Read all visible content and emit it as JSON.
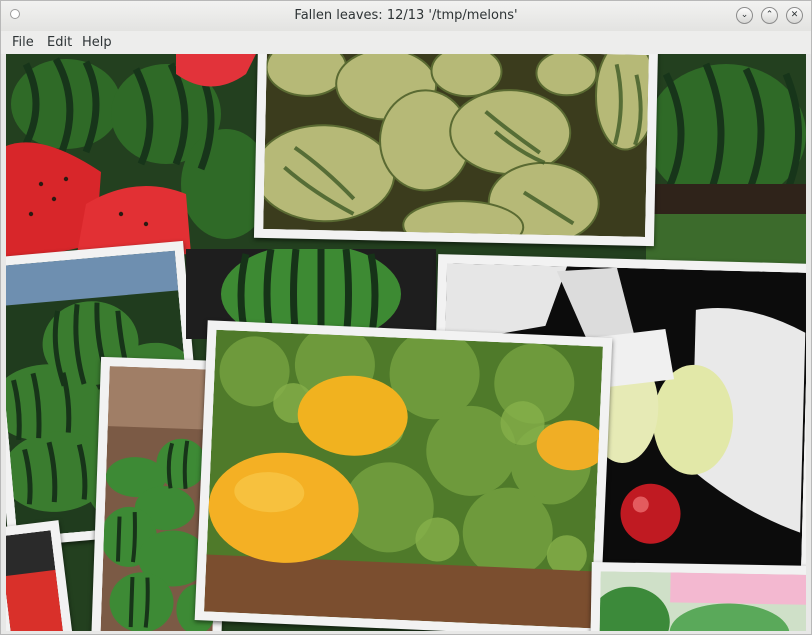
{
  "window": {
    "title": "Fallen leaves: 12/13 '/tmp/melons'",
    "minimize_icon": "chevron-down-icon",
    "maximize_icon": "chevron-up-icon",
    "close_icon": "close-icon"
  },
  "menu": {
    "file": "File",
    "edit": "Edit",
    "help": "Help"
  },
  "colors": {
    "watermelon_dark": "#1f4a1c",
    "watermelon_stripe": "#3f7b2a",
    "watermelon_flesh": "#d8262a",
    "canary_yellow": "#f0b12a",
    "pale_melon": "#c9c98a",
    "frame": "#f2f2f2"
  }
}
